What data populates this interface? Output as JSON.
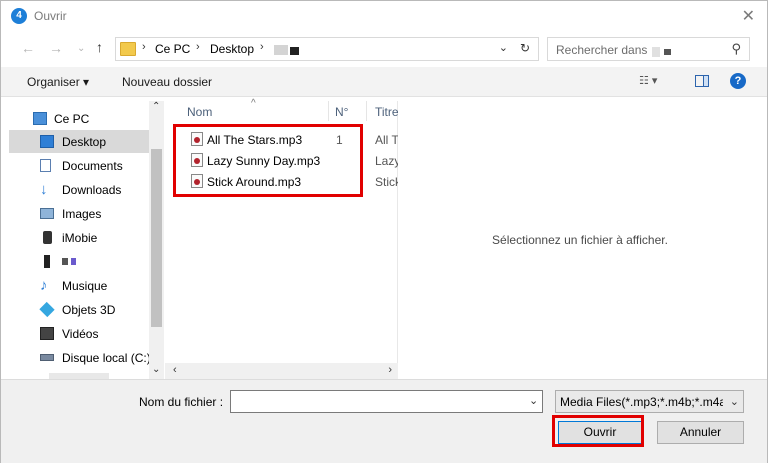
{
  "window": {
    "title": "Ouvrir",
    "app_icon_letter": "4"
  },
  "address": {
    "crumbs": [
      "Ce PC",
      "Desktop"
    ],
    "search_placeholder": "Rechercher dans"
  },
  "toolbar": {
    "organise_label": "Organiser ▾",
    "new_folder_label": "Nouveau dossier"
  },
  "sidebar": {
    "items": [
      {
        "label": "Ce PC",
        "icon": "computer-icon"
      },
      {
        "label": "Desktop",
        "icon": "desktop-icon",
        "selected": true
      },
      {
        "label": "Documents",
        "icon": "documents-icon"
      },
      {
        "label": "Downloads",
        "icon": "downloads-icon"
      },
      {
        "label": "Images",
        "icon": "images-icon"
      },
      {
        "label": "iMobie",
        "icon": "phone-icon"
      },
      {
        "label": "",
        "icon": "device-icon"
      },
      {
        "label": "Musique",
        "icon": "music-icon"
      },
      {
        "label": "Objets 3D",
        "icon": "cube-icon"
      },
      {
        "label": "Vidéos",
        "icon": "video-icon"
      },
      {
        "label": "Disque local (C:)",
        "icon": "drive-icon"
      }
    ]
  },
  "filelist": {
    "columns": {
      "name": "Nom",
      "number": "N°",
      "title": "Titre"
    },
    "files": [
      {
        "name": "All The Stars.mp3",
        "number": "1",
        "title": "All T"
      },
      {
        "name": "Lazy Sunny Day.mp3",
        "number": "",
        "title": "Lazy"
      },
      {
        "name": "Stick Around.mp3",
        "number": "",
        "title": "Stick"
      }
    ]
  },
  "preview": {
    "message": "Sélectionnez un fichier à afficher."
  },
  "bottom": {
    "filename_label": "Nom du fichier :",
    "filename_value": "",
    "filetype_value": "Media Files(*.mp3;*.m4b;*.m4a",
    "open_label": "Ouvrir",
    "cancel_label": "Annuler"
  },
  "colors": {
    "highlight": "#e10000",
    "accent": "#0078d7",
    "selected_bg": "#d9d9d9"
  }
}
